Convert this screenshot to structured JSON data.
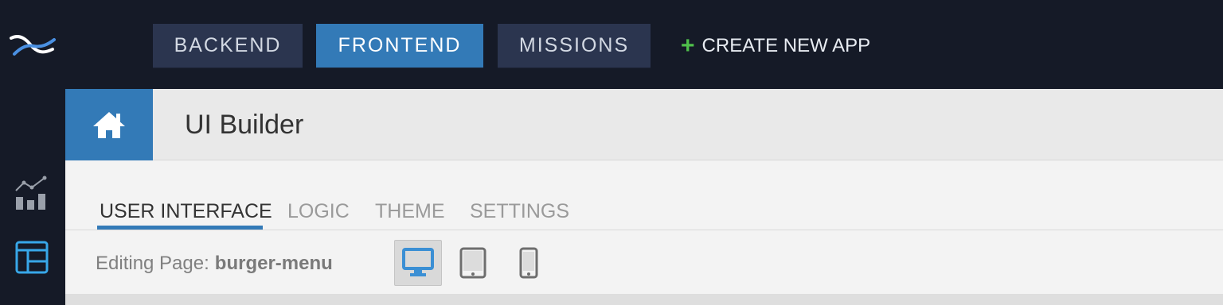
{
  "nav": {
    "tabs": [
      {
        "label": "BACKEND",
        "active": false
      },
      {
        "label": "FRONTEND",
        "active": true
      },
      {
        "label": "MISSIONS",
        "active": false
      }
    ],
    "create_label": "CREATE NEW APP",
    "create_icon": "plus-icon"
  },
  "sidebar": {
    "icons": [
      "analytics-icon",
      "layout-icon"
    ],
    "active_icon": "layout-icon"
  },
  "header": {
    "home_icon": "home-icon",
    "title": "UI Builder"
  },
  "tabs": [
    {
      "label": "USER INTERFACE",
      "active": true
    },
    {
      "label": "LOGIC",
      "active": false
    },
    {
      "label": "THEME",
      "active": false
    },
    {
      "label": "SETTINGS",
      "active": false
    }
  ],
  "editing": {
    "prefix": "Editing Page:",
    "page": "burger-menu"
  },
  "devices": [
    {
      "icon": "desktop-icon",
      "active": true
    },
    {
      "icon": "tablet-icon",
      "active": false
    },
    {
      "icon": "phone-icon",
      "active": false
    }
  ],
  "colors": {
    "accent": "#337ab7",
    "topbar": "#151a27",
    "nav_tab": "#2b354f",
    "create_plus": "#4fc04b"
  }
}
